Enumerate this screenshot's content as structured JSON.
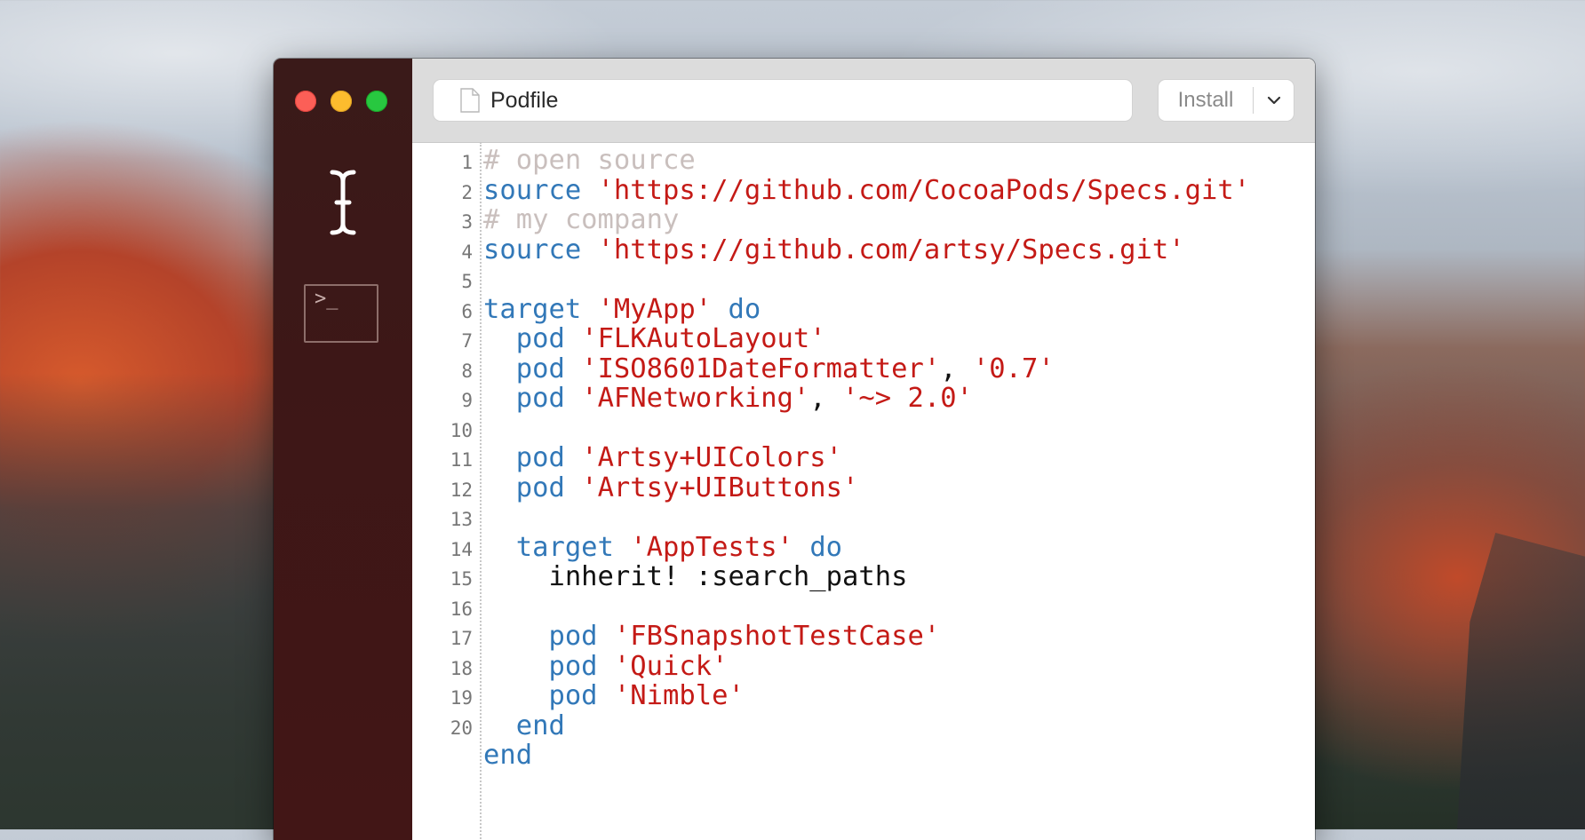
{
  "window": {
    "file_name": "Podfile",
    "install_label": "Install",
    "traffic_lights": {
      "close": "#fc5f57",
      "minimize": "#fdbc2e",
      "maximize": "#28c840"
    }
  },
  "sidebar": {
    "icons": [
      "text-cursor-icon",
      "terminal-icon"
    ],
    "terminal_glyph": ">_"
  },
  "colors": {
    "keyword": "#3278b8",
    "string": "#c41a16",
    "comment": "#c9bfbd",
    "sidebar_bg": "#3d1717"
  },
  "editor": {
    "lines": [
      {
        "n": "1",
        "tokens": [
          {
            "t": "# open source",
            "c": "cm"
          }
        ]
      },
      {
        "n": "2",
        "tokens": [
          {
            "t": "source",
            "c": "kw"
          },
          {
            "t": " ",
            "c": "pl"
          },
          {
            "t": "'https://github.com/CocoaPods/Specs.git'",
            "c": "str"
          }
        ]
      },
      {
        "n": "3",
        "tokens": [
          {
            "t": "# my company",
            "c": "cm"
          }
        ]
      },
      {
        "n": "4",
        "tokens": [
          {
            "t": "source",
            "c": "kw"
          },
          {
            "t": " ",
            "c": "pl"
          },
          {
            "t": "'https://github.com/artsy/Specs.git'",
            "c": "str"
          }
        ]
      },
      {
        "n": "5",
        "tokens": []
      },
      {
        "n": "6",
        "tokens": [
          {
            "t": "target",
            "c": "kw"
          },
          {
            "t": " ",
            "c": "pl"
          },
          {
            "t": "'MyApp'",
            "c": "str"
          },
          {
            "t": " ",
            "c": "pl"
          },
          {
            "t": "do",
            "c": "kw"
          }
        ]
      },
      {
        "n": "7",
        "tokens": [
          {
            "t": "  ",
            "c": "pl"
          },
          {
            "t": "pod",
            "c": "kw"
          },
          {
            "t": " ",
            "c": "pl"
          },
          {
            "t": "'FLKAutoLayout'",
            "c": "str"
          }
        ]
      },
      {
        "n": "8",
        "tokens": [
          {
            "t": "  ",
            "c": "pl"
          },
          {
            "t": "pod",
            "c": "kw"
          },
          {
            "t": " ",
            "c": "pl"
          },
          {
            "t": "'ISO8601DateFormatter'",
            "c": "str"
          },
          {
            "t": ", ",
            "c": "pl"
          },
          {
            "t": "'0.7'",
            "c": "str"
          }
        ]
      },
      {
        "n": "9",
        "tokens": [
          {
            "t": "  ",
            "c": "pl"
          },
          {
            "t": "pod",
            "c": "kw"
          },
          {
            "t": " ",
            "c": "pl"
          },
          {
            "t": "'AFNetworking'",
            "c": "str"
          },
          {
            "t": ", ",
            "c": "pl"
          },
          {
            "t": "'~> 2.0'",
            "c": "str"
          }
        ]
      },
      {
        "n": "10",
        "tokens": []
      },
      {
        "n": "11",
        "tokens": [
          {
            "t": "  ",
            "c": "pl"
          },
          {
            "t": "pod",
            "c": "kw"
          },
          {
            "t": " ",
            "c": "pl"
          },
          {
            "t": "'Artsy+UIColors'",
            "c": "str"
          }
        ]
      },
      {
        "n": "12",
        "tokens": [
          {
            "t": "  ",
            "c": "pl"
          },
          {
            "t": "pod",
            "c": "kw"
          },
          {
            "t": " ",
            "c": "pl"
          },
          {
            "t": "'Artsy+UIButtons'",
            "c": "str"
          }
        ]
      },
      {
        "n": "13",
        "tokens": []
      },
      {
        "n": "14",
        "tokens": [
          {
            "t": "  ",
            "c": "pl"
          },
          {
            "t": "target",
            "c": "kw"
          },
          {
            "t": " ",
            "c": "pl"
          },
          {
            "t": "'AppTests'",
            "c": "str"
          },
          {
            "t": " ",
            "c": "pl"
          },
          {
            "t": "do",
            "c": "kw"
          }
        ]
      },
      {
        "n": "15",
        "tokens": [
          {
            "t": "    inherit! :search_paths",
            "c": "pl"
          }
        ]
      },
      {
        "n": "16",
        "tokens": []
      },
      {
        "n": "17",
        "tokens": [
          {
            "t": "    ",
            "c": "pl"
          },
          {
            "t": "pod",
            "c": "kw"
          },
          {
            "t": " ",
            "c": "pl"
          },
          {
            "t": "'FBSnapshotTestCase'",
            "c": "str"
          }
        ]
      },
      {
        "n": "18",
        "tokens": [
          {
            "t": "    ",
            "c": "pl"
          },
          {
            "t": "pod",
            "c": "kw"
          },
          {
            "t": " ",
            "c": "pl"
          },
          {
            "t": "'Quick'",
            "c": "str"
          }
        ]
      },
      {
        "n": "19",
        "tokens": [
          {
            "t": "    ",
            "c": "pl"
          },
          {
            "t": "pod",
            "c": "kw"
          },
          {
            "t": " ",
            "c": "pl"
          },
          {
            "t": "'Nimble'",
            "c": "str"
          }
        ]
      },
      {
        "n": "20",
        "tokens": [
          {
            "t": "  ",
            "c": "pl"
          },
          {
            "t": "end",
            "c": "kw"
          }
        ]
      },
      {
        "n": "",
        "tokens": [
          {
            "t": "end",
            "c": "kw"
          }
        ]
      }
    ]
  }
}
